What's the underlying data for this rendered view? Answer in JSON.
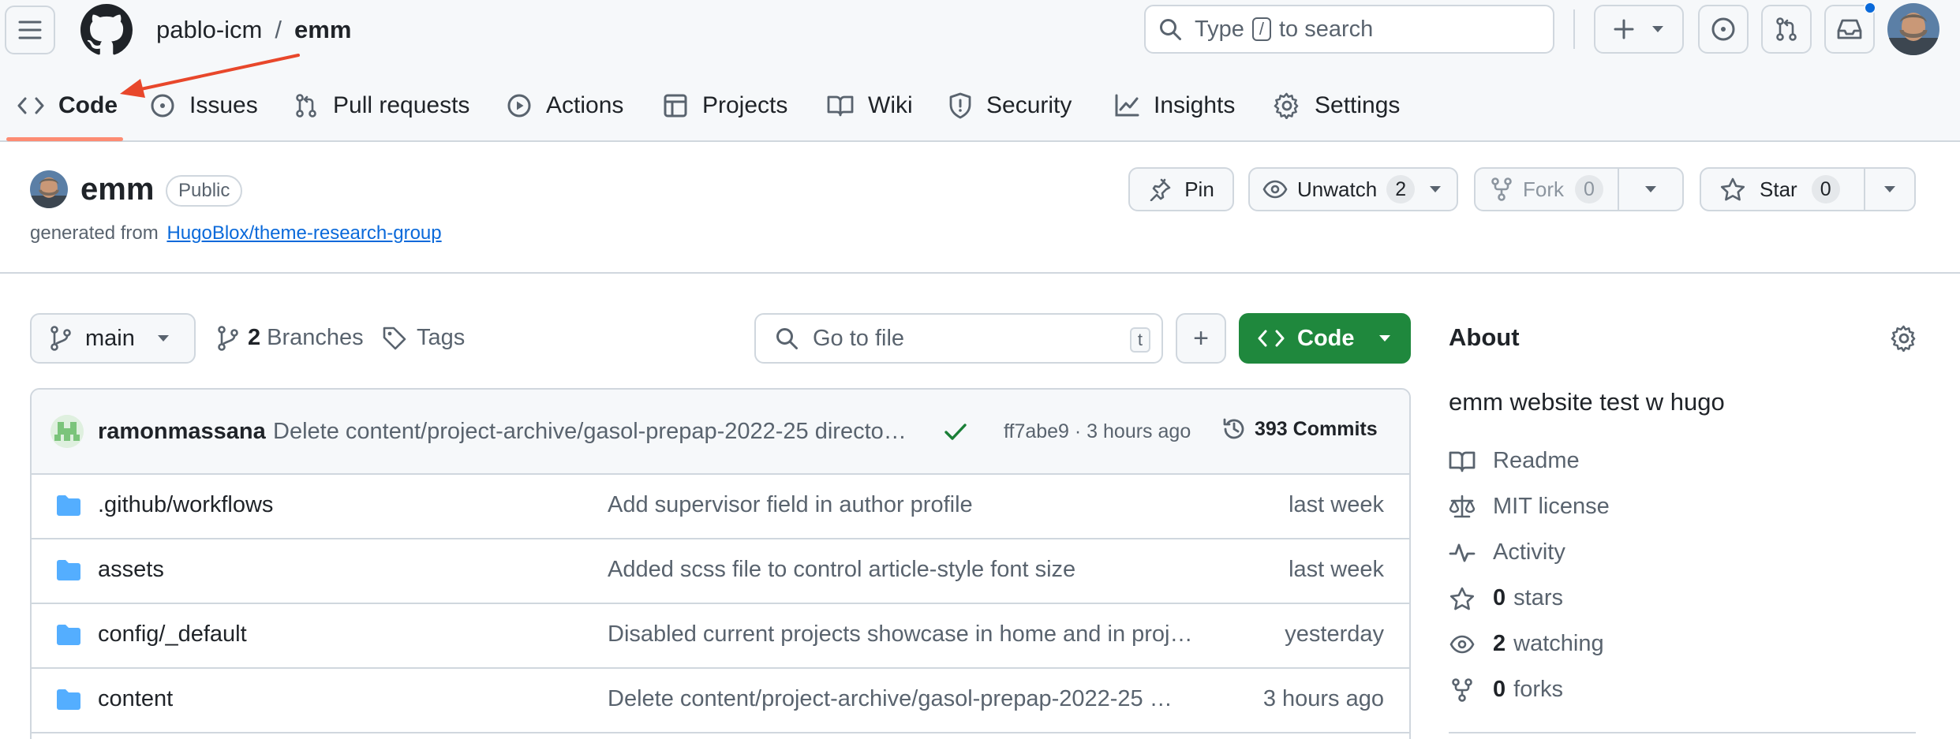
{
  "header": {
    "owner": "pablo-icm",
    "separator": "/",
    "repo": "emm",
    "search": {
      "prefix": "Type",
      "key": "/",
      "suffix": "to search"
    }
  },
  "tabs": [
    {
      "label": "Code",
      "icon": "code-icon",
      "active": true
    },
    {
      "label": "Issues",
      "icon": "issue-opened-icon"
    },
    {
      "label": "Pull requests",
      "icon": "git-pull-request-icon"
    },
    {
      "label": "Actions",
      "icon": "play-icon"
    },
    {
      "label": "Projects",
      "icon": "table-icon"
    },
    {
      "label": "Wiki",
      "icon": "book-icon"
    },
    {
      "label": "Security",
      "icon": "shield-icon"
    },
    {
      "label": "Insights",
      "icon": "graph-icon"
    },
    {
      "label": "Settings",
      "icon": "gear-icon"
    }
  ],
  "repo_head": {
    "name": "emm",
    "visibility": "Public",
    "generated_prefix": "generated from",
    "template_link": "HugoBlox/theme-research-group",
    "pin": "Pin",
    "unwatch": "Unwatch",
    "unwatch_count": "2",
    "fork": "Fork",
    "fork_count": "0",
    "star": "Star",
    "star_count": "0"
  },
  "toolbar": {
    "branch": "main",
    "branches_count": "2",
    "branches_label": "Branches",
    "tags_label": "Tags",
    "goto_placeholder": "Go to file",
    "goto_key": "t",
    "add": "+",
    "code": "Code"
  },
  "commit": {
    "author": "ramonmassana",
    "message": "Delete content/project-archive/gasol-prepap-2022-25 directo…",
    "hash_time": "ff7abe9 · 3 hours ago",
    "commits": "393 Commits"
  },
  "files": [
    {
      "name": ".github/workflows",
      "message": "Add supervisor field in author profile",
      "date": "last week"
    },
    {
      "name": "assets",
      "message": "Added scss file to control article-style font size",
      "date": "last week"
    },
    {
      "name": "config/_default",
      "message": "Disabled current projects showcase in home and in proj…",
      "date": "yesterday"
    },
    {
      "name": "content",
      "message": "Delete content/project-archive/gasol-prepap-2022-25 …",
      "date": "3 hours ago"
    }
  ],
  "about": {
    "title": "About",
    "description": "emm website test w hugo",
    "readme": "Readme",
    "license": "MIT license",
    "activity": "Activity",
    "stars_count": "0",
    "stars_label": "stars",
    "watching_count": "2",
    "watching_label": "watching",
    "forks_count": "0",
    "forks_label": "forks"
  },
  "colors": {
    "accent_underline": "#fd8c73",
    "annotation_arrow": "#e8472b",
    "code_button": "#1f883d",
    "link": "#0969da",
    "folder": "#54aeff",
    "check": "#1a7f37"
  }
}
